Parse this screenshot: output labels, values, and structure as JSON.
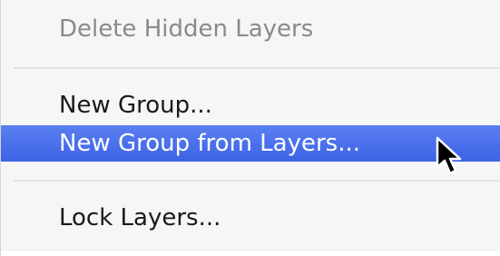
{
  "menu": {
    "items": [
      {
        "label": "Delete Hidden Layers",
        "state": "disabled"
      },
      {
        "label": "New Group...",
        "state": "normal"
      },
      {
        "label": "New Group from Layers...",
        "state": "highlighted"
      },
      {
        "label": "Lock Layers...",
        "state": "normal"
      }
    ],
    "highlight_color": "#3d63e6"
  },
  "icons": {
    "cursor": "arrow-pointer-icon"
  }
}
